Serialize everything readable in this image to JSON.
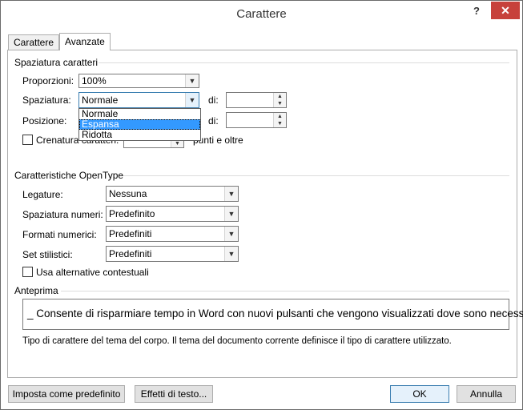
{
  "window": {
    "title": "Carattere",
    "help": "?",
    "close": "✕"
  },
  "tabs": [
    {
      "label": "Carattere"
    },
    {
      "label": "Avanzate"
    }
  ],
  "spacing_group": {
    "title": "Spaziatura caratteri",
    "proportions_label": "Proporzioni:",
    "proportions_value": "100%",
    "spacing_label": "Spaziatura:",
    "spacing_value": "Normale",
    "di1_label": "di:",
    "position_label": "Posizione:",
    "di2_label": "di:",
    "kerning_label": "Crenatura caratteri:",
    "kerning_suffix": "punti e oltre",
    "dropdown_options": [
      "Normale",
      "Espansa",
      "Ridotta"
    ],
    "dropdown_selected": "Espansa"
  },
  "opentype_group": {
    "title": "Caratteristiche OpenType",
    "ligatures_label": "Legature:",
    "ligatures_value": "Nessuna",
    "number_spacing_label": "Spaziatura numeri:",
    "number_spacing_value": "Predefinito",
    "number_forms_label": "Formati numerici:",
    "number_forms_value": "Predefiniti",
    "stylistic_sets_label": "Set stilistici:",
    "stylistic_sets_value": "Predefiniti",
    "contextual_label": "Usa alternative contestuali"
  },
  "preview_group": {
    "title": "Anteprima",
    "sample": "_ Consente di risparmiare tempo in Word con nuovi pulsanti che vengono visualizzati dove sono necessari _",
    "note": "Tipo di carattere del tema del corpo. Il tema del documento corrente definisce il tipo di carattere utilizzato."
  },
  "buttons": {
    "set_default": "Imposta come predefinito",
    "text_effects": "Effetti di testo...",
    "ok": "OK",
    "cancel": "Annulla"
  }
}
